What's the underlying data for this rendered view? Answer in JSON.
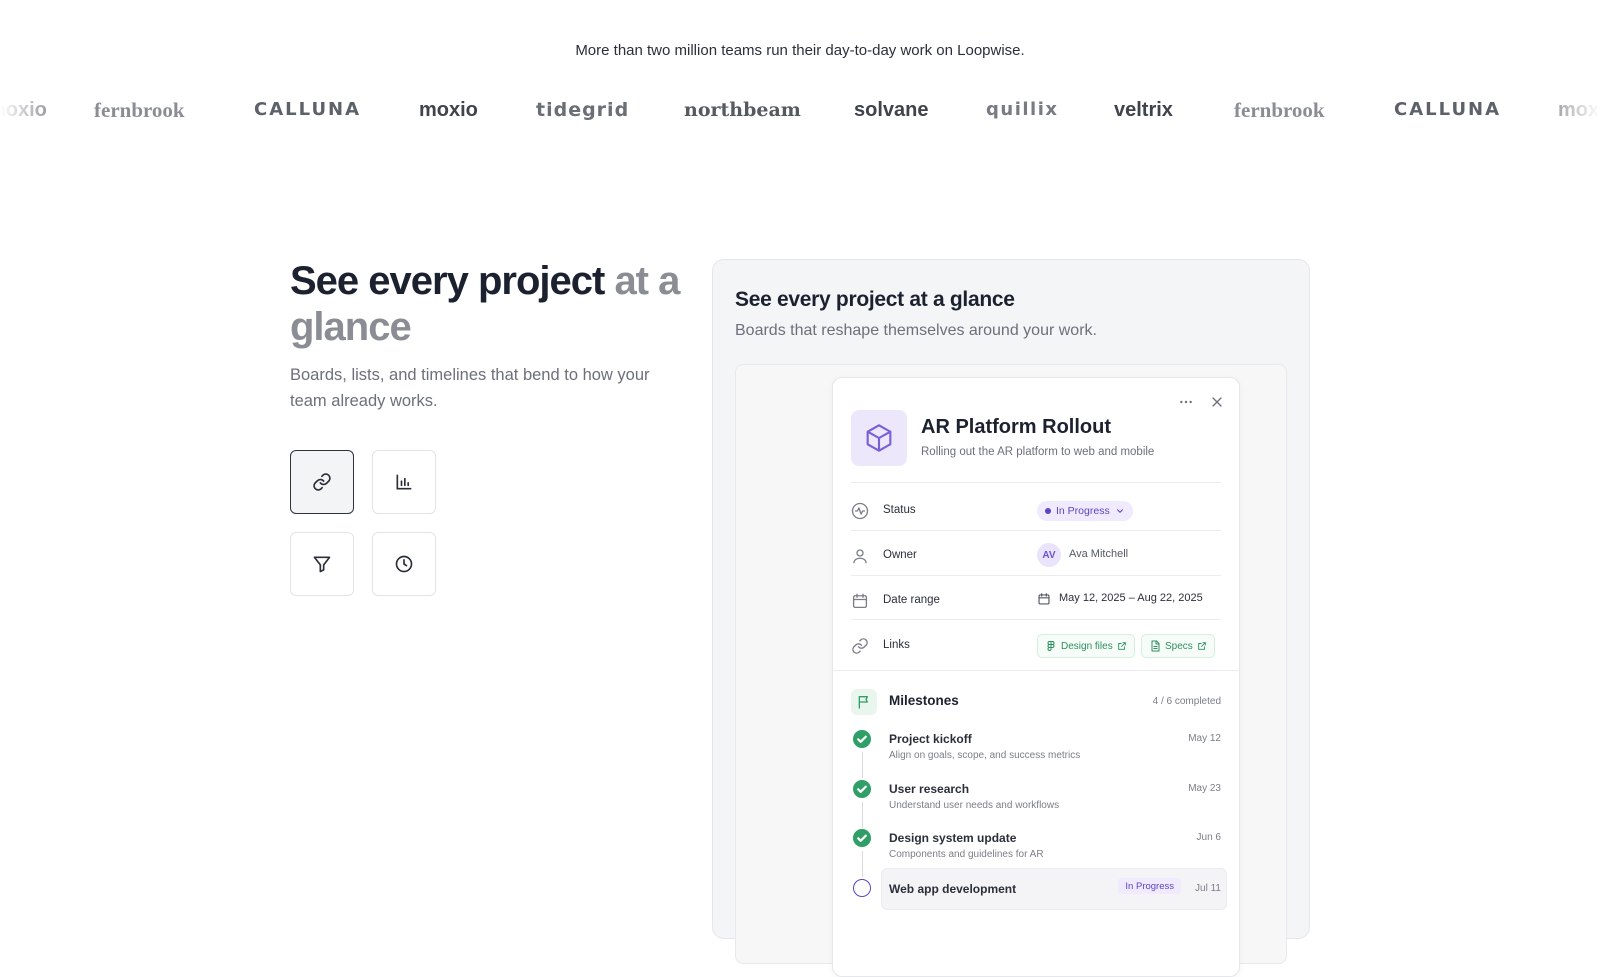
{
  "tagline": "More than two million teams run their day-to-day work on Loopwise.",
  "logos": [
    {
      "name": "moxio",
      "style": "bold"
    },
    {
      "name": "fernbrook",
      "style": "serif"
    },
    {
      "name": "CALLUNA",
      "style": "caps"
    },
    {
      "name": "moxio",
      "style": "bold"
    },
    {
      "name": "tidegrid",
      "style": "mono"
    },
    {
      "name": "northbeam",
      "style": "sserif"
    },
    {
      "name": "solvane",
      "style": "bold"
    },
    {
      "name": "quillix",
      "style": "light"
    },
    {
      "name": "veltrix",
      "style": "bold"
    },
    {
      "name": "fernbrook",
      "style": "serif"
    },
    {
      "name": "CALLUNA",
      "style": "caps"
    },
    {
      "name": "moxio",
      "style": "bold"
    }
  ],
  "hero": {
    "title_main": "See every project",
    "title_muted": "at a glance",
    "subtitle": "Boards, lists, and timelines that bend to how your team already works."
  },
  "feature_icons": [
    {
      "icon": "link-icon",
      "active": true
    },
    {
      "icon": "bar-chart-icon",
      "active": false
    },
    {
      "icon": "filter-icon",
      "active": false
    },
    {
      "icon": "clock-icon",
      "active": false
    }
  ],
  "card": {
    "title": "See every project at a glance",
    "subtitle": "Boards that reshape themselves around your work."
  },
  "project": {
    "title": "AR Platform Rollout",
    "subtitle": "Rolling out the AR platform to web and mobile",
    "icon": "cube-icon",
    "accent": "#5b45c4",
    "fields": {
      "status_label": "Status",
      "status_value": "In Progress",
      "owner_label": "Owner",
      "owner_initials": "AV",
      "owner_name": "Ava Mitchell",
      "date_label": "Date range",
      "date_value": "May 12, 2025 – Aug 22, 2025",
      "links_label": "Links",
      "link_design": "Design files",
      "link_specs": "Specs"
    },
    "milestones": {
      "title": "Milestones",
      "count": "4 / 6 completed",
      "items": [
        {
          "name": "Project kickoff",
          "desc": "Align on goals, scope, and success metrics",
          "date": "May 12",
          "done": true
        },
        {
          "name": "User research",
          "desc": "Understand user needs and workflows",
          "date": "May 23",
          "done": true
        },
        {
          "name": "Design system update",
          "desc": "Components and guidelines for AR",
          "date": "Jun 6",
          "done": true
        },
        {
          "name": "Web app development",
          "badge": "In Progress",
          "date": "Jul 11",
          "done": false
        }
      ]
    },
    "success_color": "#2f9e67"
  }
}
